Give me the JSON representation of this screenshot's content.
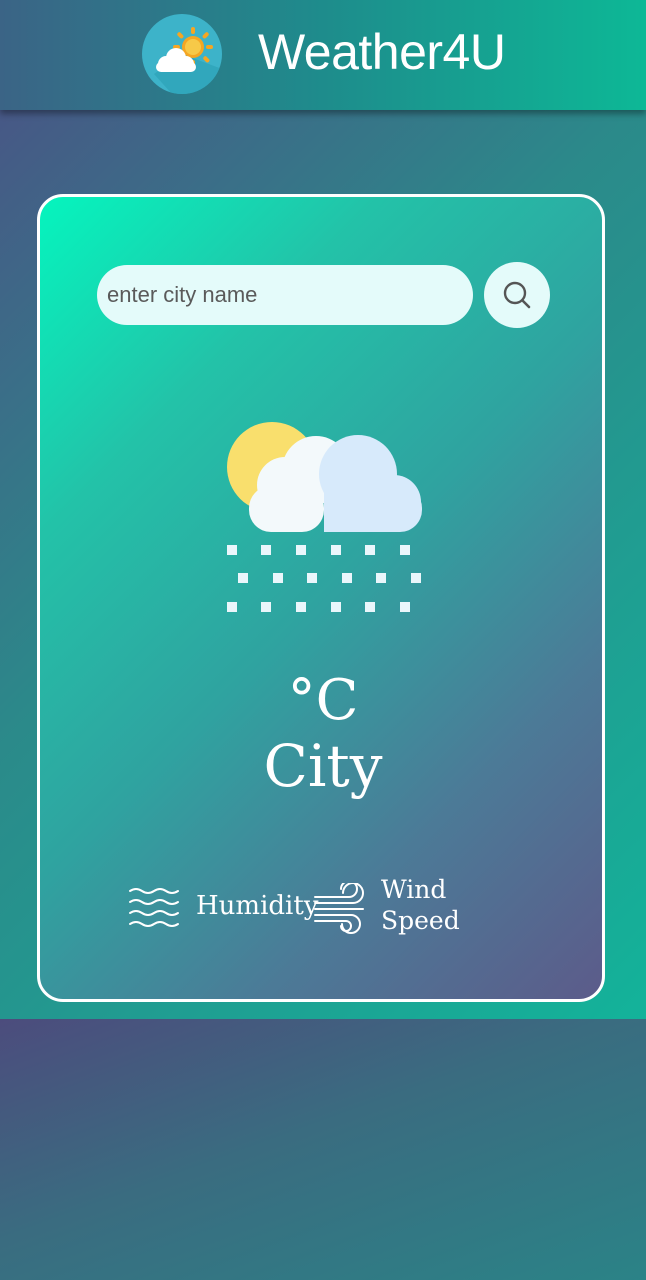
{
  "app": {
    "title": "Weather4U",
    "logo_icon": "sun-cloud-icon"
  },
  "search": {
    "placeholder": "enter city name",
    "value": "",
    "button_icon": "search-icon"
  },
  "weather": {
    "icon": "snow-cloud-icon",
    "temperature_unit": "°C",
    "city": "City",
    "humidity_label": "Humidity",
    "humidity_icon": "waves-icon",
    "wind_label": "Wind Speed",
    "wind_icon": "wind-icon"
  },
  "colors": {
    "card_gradient_start": "#05f5be",
    "card_gradient_end": "#5c5b8a",
    "header_start": "#3b6486",
    "header_end": "#0db896",
    "input_bg": "#e4fbfa"
  }
}
